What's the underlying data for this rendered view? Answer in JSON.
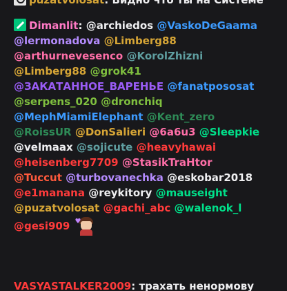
{
  "chat": {
    "top_message": {
      "username": "puzatvolosat",
      "username_color": "#d6a536",
      "separator": ":",
      "text": "Видно что ты на Системе"
    },
    "main_message": {
      "username": "Dimanlit",
      "username_color": "#ff7ac5",
      "separator": ":",
      "badge_icon": "sword-badge-icon",
      "lines": [
        [
          {
            "text": "@archiedos",
            "color": "#efeff1"
          },
          {
            "text": "@VaskoDeGaama",
            "color": "#3d9bff"
          }
        ],
        [
          {
            "text": "@lermonadova",
            "color": "#b58cff"
          },
          {
            "text": "@Limberg88",
            "color": "#d6a536"
          }
        ],
        [
          {
            "text": "@arthurnevesenco",
            "color": "#ff6fa8"
          },
          {
            "text": "@KorolZhizni",
            "color": "#5f9ea0"
          }
        ],
        [
          {
            "text": "@Limberg88",
            "color": "#d6a536"
          },
          {
            "text": "@grok41",
            "color": "#7fbf3f"
          }
        ],
        [
          {
            "text": "@ЗАКАТАННОЕ_ВАРЕНЬЕ",
            "color": "#9a5cf5"
          },
          {
            "text": "@fanatpososat",
            "color": "#3d9bff"
          }
        ],
        [
          {
            "text": "@serpens_020",
            "color": "#7fbf3f"
          },
          {
            "text": "@dronchiq",
            "color": "#7fbf3f"
          }
        ],
        [
          {
            "text": "@MephMiamiElephant",
            "color": "#3d9bff"
          },
          {
            "text": "@Kent_zero",
            "color": "#2e8b57"
          }
        ],
        [
          {
            "text": "@RoissUR",
            "color": "#2e8b57"
          },
          {
            "text": "@DonSalieri",
            "color": "#d6a536"
          },
          {
            "text": "@6a6u3",
            "color": "#ff6fa8"
          },
          {
            "text": "@Sleepkie",
            "color": "#00e08a"
          }
        ],
        [
          {
            "text": "@velmaax",
            "color": "#efeff1"
          },
          {
            "text": "@sojicute",
            "color": "#5f9ea0"
          },
          {
            "text": "@heavyhawai",
            "color": "#ff3b3b"
          }
        ],
        [
          {
            "text": "@heisenberg7709",
            "color": "#ff3b3b"
          },
          {
            "text": "@StasikTraHtor",
            "color": "#ff6fa8"
          }
        ],
        [
          {
            "text": "@Tuccut",
            "color": "#ff5a3d"
          },
          {
            "text": "@turbovanechka",
            "color": "#b58cff"
          },
          {
            "text": "@eskobar2018",
            "color": "#efeff1"
          }
        ],
        [
          {
            "text": "@e1manana",
            "color": "#ff3b3b"
          },
          {
            "text": "@reykitory",
            "color": "#efeff1"
          },
          {
            "text": "@mauseight",
            "color": "#00e08a"
          }
        ],
        [
          {
            "text": "@puzatvolosat",
            "color": "#d6a536"
          },
          {
            "text": "@gachi_abc",
            "color": "#ff3b3b"
          },
          {
            "text": "@walenok_l",
            "color": "#00e08a"
          }
        ],
        [
          {
            "text": "@gesi909",
            "color": "#ff3b3b"
          }
        ]
      ],
      "emote": "anime-girl-emote"
    },
    "bottom_message": {
      "username": "VASYASTALKER2009",
      "username_color": "#ff3b3b",
      "separator": ":",
      "text": "трахать ненормову"
    }
  }
}
